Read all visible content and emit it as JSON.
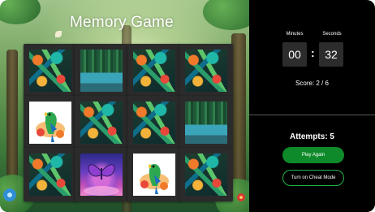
{
  "game": {
    "title": "Memory Game",
    "cards": [
      {
        "face": "back"
      },
      {
        "face": "lake"
      },
      {
        "face": "back"
      },
      {
        "face": "back"
      },
      {
        "face": "parrot"
      },
      {
        "face": "back"
      },
      {
        "face": "back"
      },
      {
        "face": "lake"
      },
      {
        "face": "back"
      },
      {
        "face": "butterfly"
      },
      {
        "face": "parrot"
      },
      {
        "face": "back"
      }
    ]
  },
  "timer": {
    "minutes_label": "Minutes",
    "seconds_label": "Seconds",
    "minutes": "00",
    "separator": ":",
    "seconds": "32"
  },
  "score": {
    "text": "Score: 2 / 6"
  },
  "attempts": {
    "text": "Attempts: 5"
  },
  "buttons": {
    "play_again": "Play Again",
    "cheat_mode": "Turn on Cheat Mode"
  },
  "colors": {
    "panel_bg": "#000000",
    "timer_box": "#2c2c2c",
    "play_button": "#0f8a2a",
    "cheat_border": "#24b34a"
  }
}
